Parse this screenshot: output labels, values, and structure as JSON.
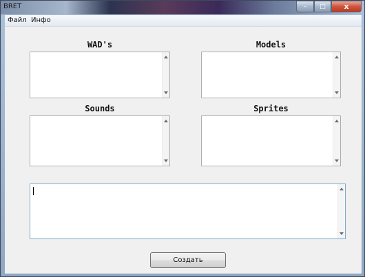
{
  "window": {
    "title": "BRET",
    "minimize_glyph": "–",
    "maximize_glyph": "□",
    "close_glyph": "x"
  },
  "menu": {
    "file": "Файл",
    "info": "Инфо"
  },
  "panels": {
    "wads": "WAD's",
    "models": "Models",
    "sounds": "Sounds",
    "sprites": "Sprites"
  },
  "output": {
    "value": ""
  },
  "actions": {
    "create_label": "Создать"
  }
}
